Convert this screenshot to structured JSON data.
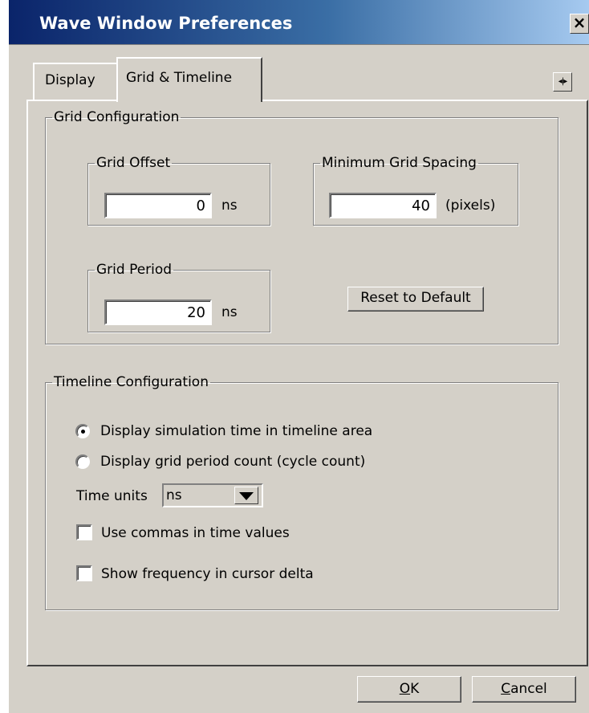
{
  "window": {
    "title": "Wave Window Preferences",
    "close_glyph": "×"
  },
  "tabs": [
    {
      "label": "Display",
      "selected": false
    },
    {
      "label": "Grid & Timeline",
      "selected": true
    }
  ],
  "tab_scroll_glyph": "◂|▸",
  "grid_config": {
    "legend": "Grid Configuration",
    "grid_offset": {
      "legend": "Grid Offset",
      "value": "0",
      "unit": "ns"
    },
    "min_grid_spacing": {
      "legend": "Minimum Grid Spacing",
      "value": "40",
      "unit": "(pixels)"
    },
    "grid_period": {
      "legend": "Grid Period",
      "value": "20",
      "unit": "ns"
    },
    "reset_label": "Reset to Default"
  },
  "timeline_config": {
    "legend": "Timeline Configuration",
    "radio_sim_time": {
      "label": "Display simulation time in timeline area",
      "checked": true
    },
    "radio_cycle_count": {
      "label": "Display grid period count (cycle count)",
      "checked": false
    },
    "time_units_label": "Time units",
    "time_units_value": "ns",
    "use_commas": {
      "label": "Use commas in time values",
      "checked": false
    },
    "show_frequency": {
      "label": "Show frequency in cursor delta",
      "checked": false
    }
  },
  "buttons": {
    "ok_mnemonic": "O",
    "ok_rest": "K",
    "cancel_mnemonic": "C",
    "cancel_rest": "ancel"
  },
  "colors": {
    "face": "#d4d0c8",
    "titlebar_start": "#0a246a",
    "titlebar_end": "#a6caf0"
  }
}
